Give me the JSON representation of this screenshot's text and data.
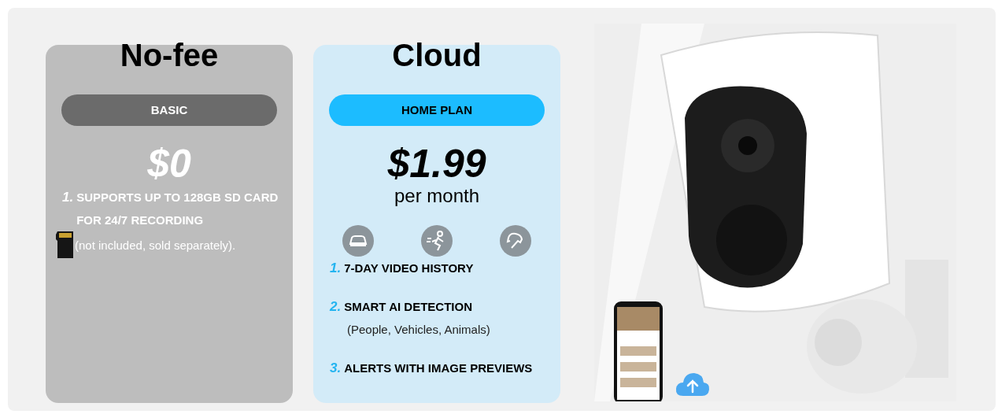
{
  "plans": [
    {
      "kind": "basic",
      "heading": "No-fee",
      "badge": "BASIC",
      "price": "$0",
      "features": [
        {
          "number": "1.",
          "text": "SUPPORTS UP TO 128GB SD CARD FOR 24/7 RECORDING",
          "note": "(not included, sold separately).",
          "card_icon": true
        }
      ]
    },
    {
      "kind": "cloud",
      "heading": "Cloud",
      "badge": "HOME PLAN",
      "price": "$1.99",
      "period": "per month",
      "features": [
        {
          "number": "1.",
          "text": "7-DAY VIDEO HISTORY"
        },
        {
          "number": "2.",
          "text": "SMART AI DETECTION",
          "note": "(People, Vehicles, Animals)"
        },
        {
          "number": "3.",
          "text": "ALERTS WITH IMAGE PREVIEWS"
        }
      ]
    }
  ]
}
